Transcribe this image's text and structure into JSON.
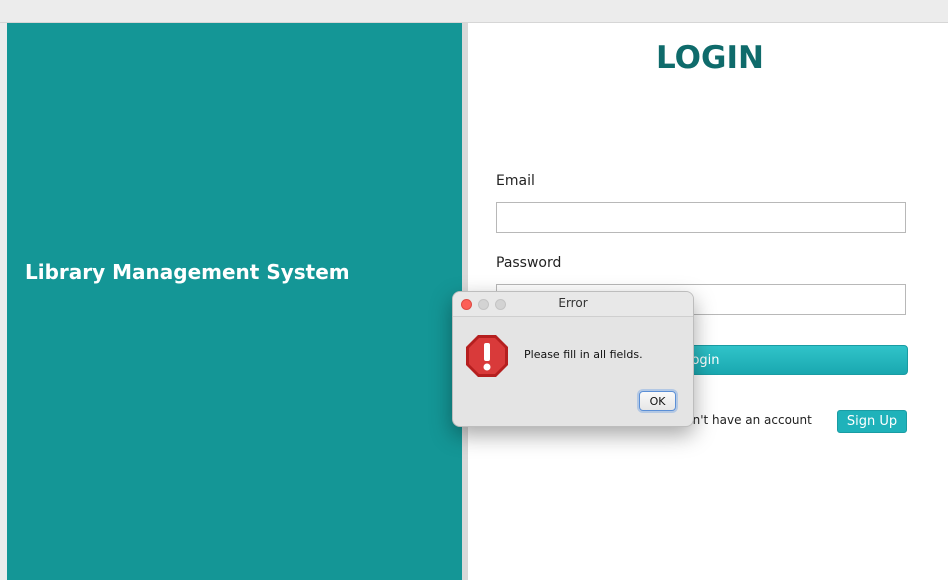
{
  "app": {
    "title": "Library Management System"
  },
  "login": {
    "heading": "LOGIN",
    "email_label": "Email",
    "email_value": "",
    "password_label": "Password",
    "password_value": "",
    "login_button": "Login",
    "no_account_text": "Don't have an account",
    "signup_button": "Sign Up"
  },
  "dialog": {
    "title": "Error",
    "message": "Please fill in all fields.",
    "ok_button": "OK",
    "icon": "error-stop-icon"
  },
  "colors": {
    "brand_teal": "#149696",
    "heading_teal": "#0f6b6b",
    "button_teal": "#1fb2ba",
    "error_red": "#cf2a2a"
  }
}
